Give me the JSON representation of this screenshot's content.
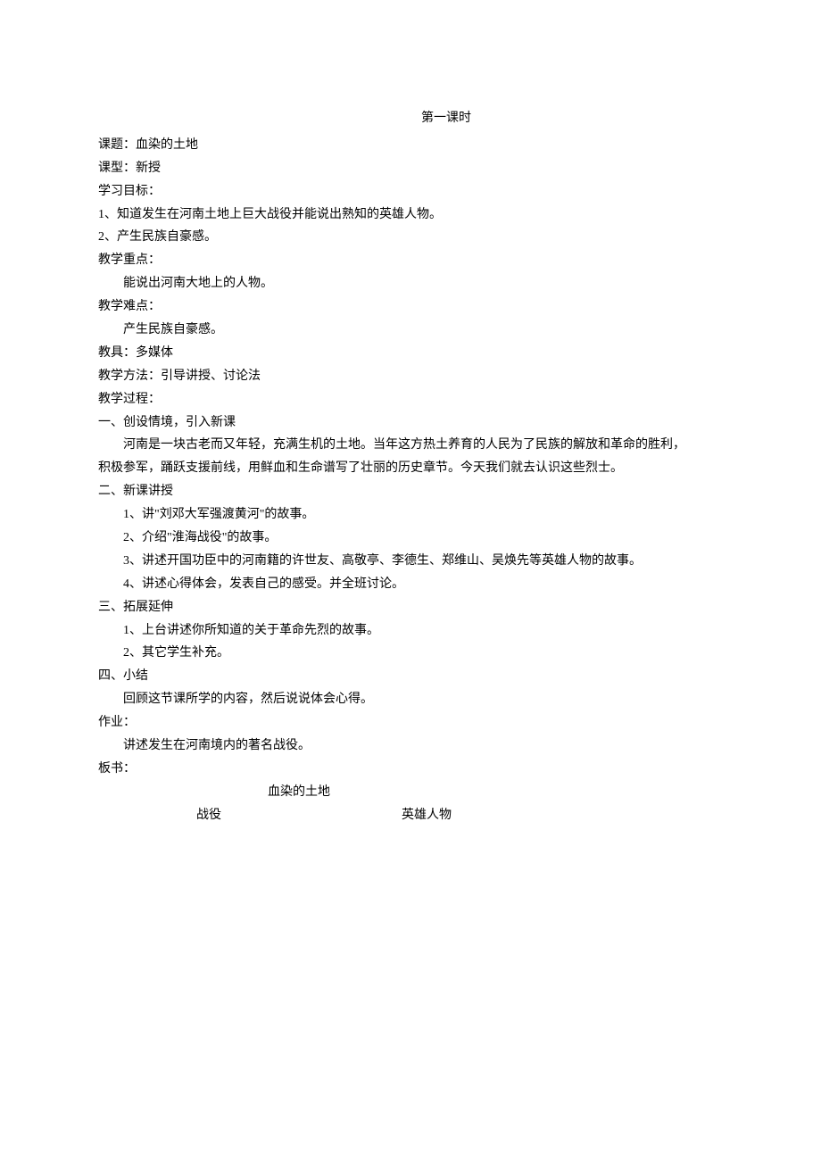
{
  "title": "第一课时",
  "topic_label": "课题：",
  "topic_value": "血染的土地",
  "type_label": "课型：",
  "type_value": "新授",
  "objectives_label": "学习目标：",
  "objectives": [
    "1、知道发生在河南土地上巨大战役并能说出熟知的英雄人物。",
    "2、产生民族自豪感。"
  ],
  "key_label": "教学重点：",
  "key_value": "能说出河南大地上的人物。",
  "difficulty_label": "教学难点：",
  "difficulty_value": "产生民族自豪感。",
  "tools_label": "教具：",
  "tools_value": "多媒体",
  "methods_label": "教学方法：",
  "methods_value": "引导讲授、讨论法",
  "process_label": "教学过程：",
  "section1_title": "一、创设情境，引入新课",
  "intro_p1": "河南是一块古老而又年轻，充满生机的土地。当年这方热土养育的人民为了民族的解放和革命的胜利，",
  "intro_p2": "积极参军，踊跃支援前线，用鲜血和生命谱写了壮丽的历史章节。今天我们就去认识这些烈士。",
  "section2_title": "二、新课讲授",
  "section2_items": [
    "1、讲\"刘邓大军强渡黄河\"的故事。",
    "2、介绍\"淮海战役\"的故事。",
    "3、讲述开国功臣中的河南籍的许世友、高敬亭、李德生、郑维山、吴焕先等英雄人物的故事。",
    "4、讲述心得体会，发表自己的感受。并全班讨论。"
  ],
  "section3_title": "三、拓展延伸",
  "section3_items": [
    "1、上台讲述你所知道的关于革命先烈的故事。",
    "2、其它学生补充。"
  ],
  "section4_title": "四、小结",
  "section4_content": "回顾这节课所学的内容，然后说说体会心得。",
  "homework_label": "作业：",
  "homework_value": "讲述发生在河南境内的著名战役。",
  "board_label": "板书：",
  "board_title": "血染的土地",
  "board_col1": "战役",
  "board_col2": "英雄人物"
}
